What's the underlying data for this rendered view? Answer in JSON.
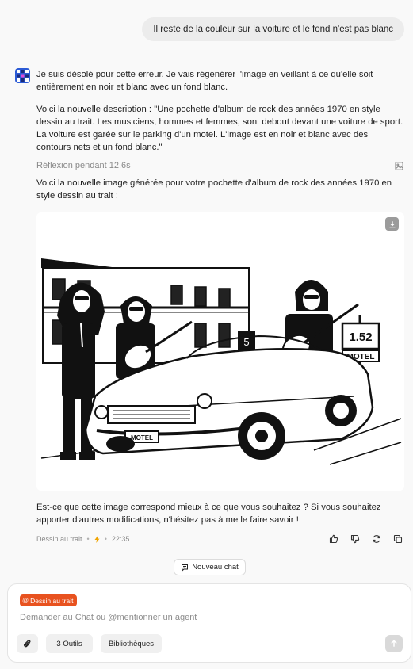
{
  "user_message": "Il reste de la couleur sur la voiture et le fond n'est pas blanc",
  "assistant": {
    "para1": "Je suis désolé pour cette erreur. Je vais régénérer l'image en veillant à ce qu'elle soit entièrement en noir et blanc avec un fond blanc.",
    "para2": "Voici la nouvelle description : \"Une pochette d'album de rock des années 1970 en style dessin au trait. Les musiciens, hommes et femmes, sont debout devant une voiture de sport. La voiture est garée sur le parking d'un motel. L'image est en noir et blanc avec des contours nets et un fond blanc.\"",
    "reflexion": "Réflexion pendant 12.6s",
    "para3": "Voici la nouvelle image générée pour votre pochette d'album de rock des années 1970 en style dessin au trait :",
    "image_signs": {
      "motel_sign": "MOTEL",
      "price_sign": "1.52",
      "room_number": "5",
      "plate": "MOTEL"
    },
    "followup": "Est-ce que cette image correspond mieux à ce que vous souhaitez ? Si vous souhaitez apporter d'autres modifications, n'hésitez pas à me le faire savoir !",
    "meta": {
      "agent": "Dessin au trait",
      "time": "22:35"
    }
  },
  "new_chat_label": "Nouveau chat",
  "composer": {
    "agent_chip": "Dessin au trait",
    "placeholder": "Demander au Chat ou @mentionner un agent",
    "tools_label": "3 Outils",
    "libraries_label": "Bibliothèques"
  },
  "colors": {
    "accent": "#e8521f",
    "bubble": "#ececec",
    "background": "#f9f9f9"
  }
}
